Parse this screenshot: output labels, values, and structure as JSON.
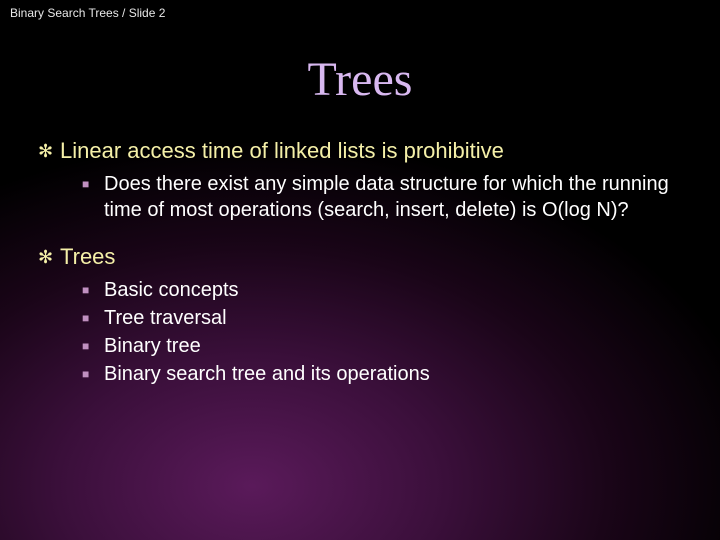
{
  "header": {
    "breadcrumb": "Binary Search Trees / Slide 2"
  },
  "title": "Trees",
  "bullets": {
    "p1": {
      "text": "Linear access time of linked lists is prohibitive",
      "sub1": "Does there exist any simple data structure for which the running time of most operations (search, insert, delete) is O(log N)?"
    },
    "p2": {
      "text": "Trees",
      "sub1": "Basic concepts",
      "sub2": "Tree traversal",
      "sub3": "Binary tree",
      "sub4": "Binary search tree and its operations"
    }
  }
}
